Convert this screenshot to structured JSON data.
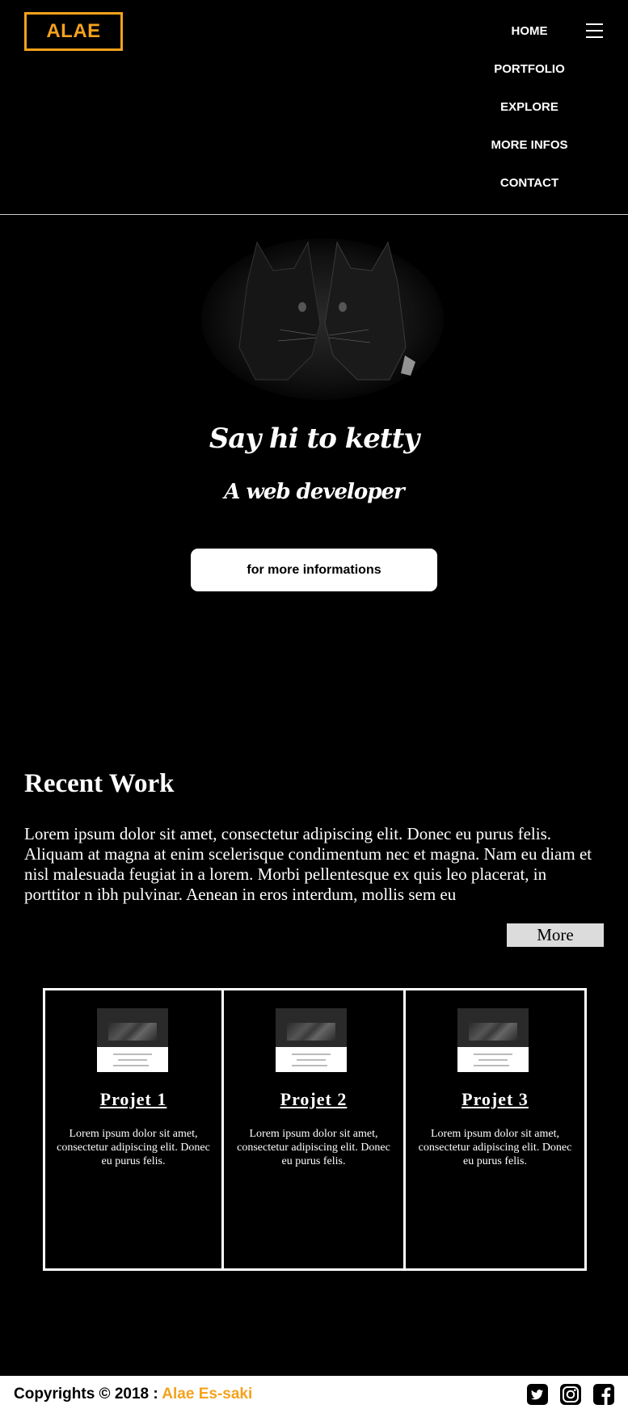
{
  "header": {
    "logo": "ALAE",
    "nav": [
      "HOME",
      "PORTFOLIO",
      "EXPLORE",
      "MORE INFOS",
      "CONTACT"
    ]
  },
  "hero": {
    "title": "Say hi to ketty",
    "subtitle": "A web developer",
    "button_label": "for more informations"
  },
  "recent_work": {
    "title": "Recent Work",
    "text": "Lorem ipsum dolor sit amet, consectetur adipiscing elit. Donec eu purus felis. Aliquam at magna at enim scelerisque condimentum nec et magna. Nam eu diam et nisl malesuada feugiat in a lorem. Morbi pellentesque ex quis leo placerat, in porttitor n ibh pulvinar. Aenean in eros interdum, mollis sem eu",
    "more_label": "More"
  },
  "projects": [
    {
      "title": "Projet 1",
      "text": "Lorem ipsum dolor sit amet, consectetur adipiscing elit. Donec eu purus felis."
    },
    {
      "title": "Projet 2",
      "text": "Lorem ipsum dolor sit amet, consectetur adipiscing elit. Donec eu purus felis."
    },
    {
      "title": "Projet 3",
      "text": "Lorem ipsum dolor sit amet, consectetur adipiscing elit. Donec eu purus felis."
    }
  ],
  "footer": {
    "copyright": "Copyrights © 2018 :",
    "author": "Alae Es-saki",
    "social": [
      "twitter-icon",
      "instagram-icon",
      "facebook-icon"
    ]
  },
  "colors": {
    "accent": "#f5a21d",
    "background": "#000000",
    "footer_bg": "#ffffff"
  }
}
